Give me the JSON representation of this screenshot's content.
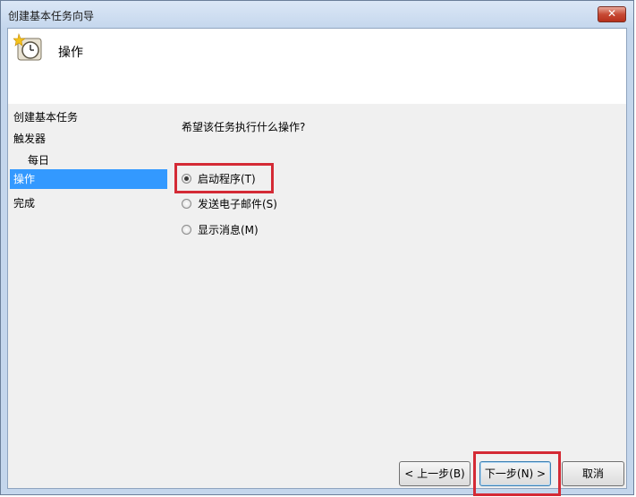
{
  "window": {
    "title": "创建基本任务向导",
    "close_label": "✕"
  },
  "header": {
    "title": "操作",
    "icon": "clock-icon"
  },
  "nav": {
    "items": [
      {
        "label": "创建基本任务",
        "active": false
      },
      {
        "label": "触发器",
        "active": false
      },
      {
        "label": "每日",
        "active": false,
        "sub": true
      },
      {
        "label": "操作",
        "active": true
      },
      {
        "label": "完成",
        "active": false
      }
    ]
  },
  "content": {
    "question": "希望该任务执行什么操作?",
    "options": [
      {
        "label": "启动程序(T)",
        "checked": true
      },
      {
        "label": "发送电子邮件(S)",
        "checked": false
      },
      {
        "label": "显示消息(M)",
        "checked": false
      }
    ]
  },
  "buttons": {
    "back": "< 上一步(B)",
    "next": "下一步(N) >",
    "cancel": "取消"
  },
  "colors": {
    "selection": "#3399ff",
    "highlight_box": "#d42a35"
  }
}
